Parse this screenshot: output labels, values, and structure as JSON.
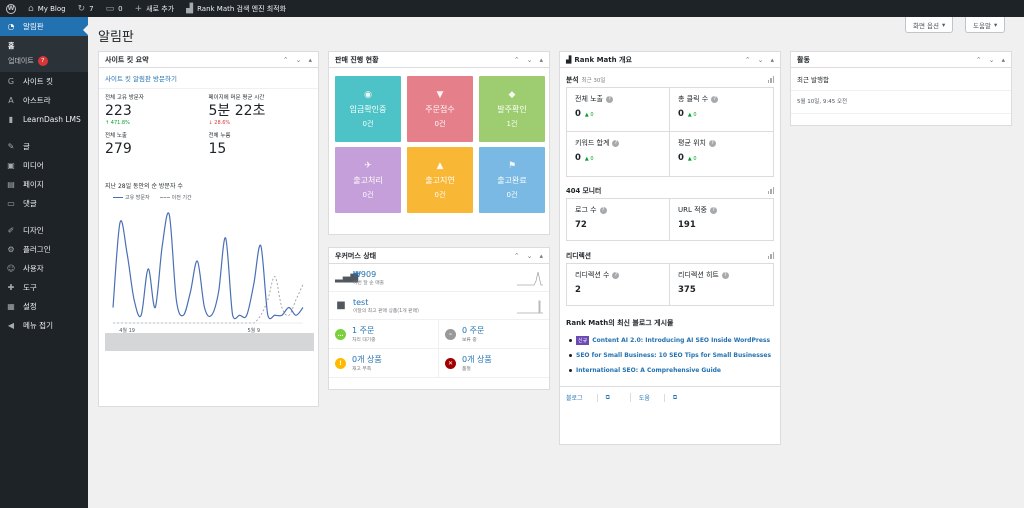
{
  "adminbar": {
    "site_name": "My Blog",
    "updates_count": "7",
    "comments_count": "0",
    "new_label": "새로 추가",
    "rankmath_label": "Rank Math 검색 엔진 최적화"
  },
  "sidebar": {
    "dashboard": "알림판",
    "home": "홈",
    "updates": "업데이트",
    "updates_badge": "7",
    "items": [
      "사이트 킷",
      "아스트라",
      "LearnDash LMS",
      "글",
      "미디어",
      "페이지",
      "댓글",
      "디자인",
      "플러그인",
      "사용자",
      "도구",
      "설정",
      "메뉴 접기"
    ]
  },
  "header": {
    "title": "알림판",
    "screen_options": "화면 옵션",
    "help": "도움말"
  },
  "sitekit": {
    "title": "사이트 킷 요약",
    "link": "사이트 킷 알림판 방문하기",
    "metrics": [
      {
        "label": "전체 고유 방문자",
        "value": "223",
        "delta": "↑ 471.8%",
        "dir": "up"
      },
      {
        "label": "페이지에 머문 평균 시간",
        "value": "5분 22초",
        "delta": "↓ 28.6%",
        "dir": "down"
      },
      {
        "label": "전체 노출",
        "value": "279",
        "delta": "",
        "dir": ""
      },
      {
        "label": "전체 누름",
        "value": "15",
        "delta": "",
        "dir": ""
      }
    ],
    "chart_title": "지난 28일 동안의 순 방문자 수",
    "legend_current": "고유 방문자",
    "legend_previous": "이전 기간",
    "tick_1": "4월 19",
    "tick_2": "5월 9"
  },
  "chart_data": {
    "type": "line",
    "series": [
      {
        "name": "고유 방문자",
        "values": [
          2,
          13,
          9,
          3,
          1,
          7,
          2,
          10,
          14,
          3,
          1,
          4,
          8,
          2,
          1,
          4,
          11,
          1,
          1,
          1,
          5,
          10,
          1,
          1,
          1,
          2,
          1,
          2
        ]
      },
      {
        "name": "이전 기간",
        "values": [
          0,
          0,
          0,
          0,
          0,
          0,
          0,
          0,
          0,
          0,
          0,
          0,
          0,
          0,
          0,
          0,
          0,
          0,
          0,
          0,
          0,
          1,
          3,
          6,
          2,
          1,
          3,
          5
        ]
      }
    ],
    "ylim": [
      0,
      15
    ],
    "grid": false,
    "legend": "top"
  },
  "sales": {
    "title": "판매 진행 현황",
    "tiles": [
      {
        "label": "입금확인중",
        "count": "0건",
        "color": "#4dc3c7",
        "icon": "eye-icon",
        "glyph": "◉"
      },
      {
        "label": "주문접수",
        "count": "0건",
        "color": "#e57f8a",
        "icon": "cart-icon",
        "glyph": "▼"
      },
      {
        "label": "발주확인",
        "count": "1건",
        "color": "#9dcd70",
        "icon": "tag-icon",
        "glyph": "◆"
      },
      {
        "label": "출고처리",
        "count": "0건",
        "color": "#c59fd9",
        "icon": "plane-icon",
        "glyph": "✈"
      },
      {
        "label": "출고지연",
        "count": "0건",
        "color": "#f8b735",
        "icon": "warning-icon",
        "glyph": "▲"
      },
      {
        "label": "출고완료",
        "count": "0건",
        "color": "#79b9e3",
        "icon": "flag-icon",
        "glyph": "⚑"
      }
    ]
  },
  "woo": {
    "title": "우커머스 상태",
    "net_sales_value": "₩909",
    "net_sales_label": "이번 달 순 매출",
    "top_seller_value": "test",
    "top_seller_label": "이달의 최고 판매 상품(1개 판매)",
    "cells": [
      {
        "value": "1 주문",
        "label": "처리 대기중",
        "color": "#7ad03a",
        "glyph": "…"
      },
      {
        "value": "0 주문",
        "label": "보류 중",
        "color": "#999999",
        "glyph": "–"
      },
      {
        "value": "0개 상품",
        "label": "재고 부족",
        "color": "#ffba00",
        "glyph": "!"
      },
      {
        "value": "0개 상품",
        "label": "품절",
        "color": "#a00000",
        "glyph": "✕"
      }
    ]
  },
  "rankmath": {
    "title": "Rank Math 개요",
    "analytics_label": "분석",
    "analytics_sub": "최근 30일",
    "analytics": [
      {
        "label": "전체 노출",
        "value": "0",
        "delta": "▲ 0"
      },
      {
        "label": "총 클릭 수",
        "value": "0",
        "delta": "▲ 0"
      },
      {
        "label": "키워드 합계",
        "value": "0",
        "delta": "▲ 0"
      },
      {
        "label": "평균 위치",
        "value": "0",
        "delta": "▲ 0"
      }
    ],
    "monitor_label": "404 모니터",
    "monitor": [
      {
        "label": "로그 수",
        "value": "72"
      },
      {
        "label": "URL 적중",
        "value": "191"
      }
    ],
    "redirect_label": "리디렉션",
    "redirects": [
      {
        "label": "리디렉션 수",
        "value": "2"
      },
      {
        "label": "리디렉션 히트",
        "value": "375"
      }
    ],
    "blog_title": "Rank Math의 최신 블로그 게시물",
    "new_badge": "신규",
    "posts": [
      "Content AI 2.0: Introducing AI SEO Inside WordPress",
      "SEO for Small Business: 10 SEO Tips for Small Businesses",
      "International SEO: A Comprehensive Guide"
    ],
    "footer_blog": "블로그",
    "footer_help": "도움"
  },
  "activity": {
    "title": "활동",
    "recent_label": "최근 발행함",
    "recent_time": "5월 10일, 9:45 오전"
  }
}
